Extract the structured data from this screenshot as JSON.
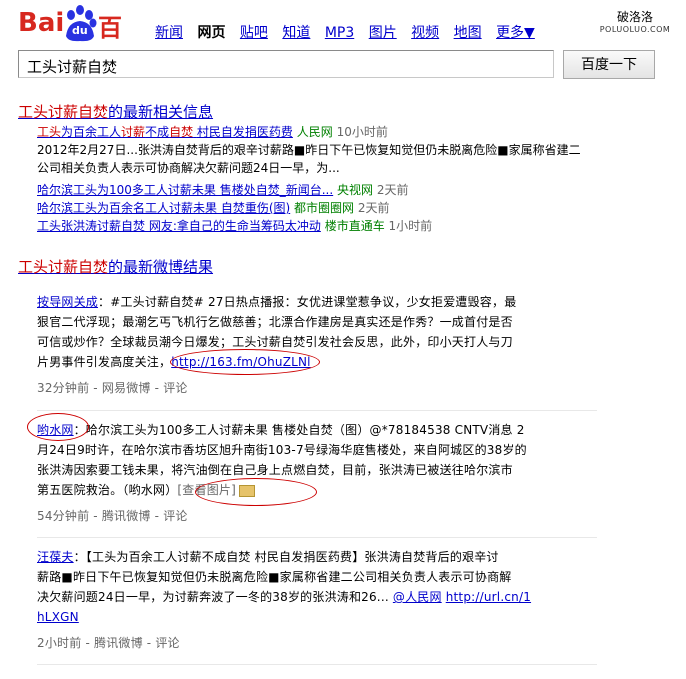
{
  "logo": {
    "bai": "Bai",
    "du": "du",
    "cn": "百度"
  },
  "nav": [
    {
      "label": "新闻",
      "current": false
    },
    {
      "label": "网页",
      "current": true
    },
    {
      "label": "贴吧",
      "current": false
    },
    {
      "label": "知道",
      "current": false
    },
    {
      "label": "MP3",
      "current": false
    },
    {
      "label": "图片",
      "current": false
    },
    {
      "label": "视频",
      "current": false
    },
    {
      "label": "地图",
      "current": false
    },
    {
      "label": "更多▼",
      "current": false
    }
  ],
  "corner": {
    "cn": "破洛洛",
    "en": "POLUOLUO.COM"
  },
  "search": {
    "query": "工头讨薪自焚",
    "button": "百度一下"
  },
  "news": {
    "heading_em": "工头讨薪自焚",
    "heading_rest": "的最新相关信息",
    "top": {
      "title_parts": [
        "工头",
        "为百余工人",
        "讨薪",
        "不成",
        "自焚",
        "村民自发捐医药费"
      ],
      "source": "人民网",
      "time": "10小时前",
      "snippet": "2012年2月27日...张洪涛自焚背后的艰辛讨薪路■昨日下午已恢复知觉但仍未脱离危险■家属称省建二公司相关负责人表示可协商解决欠薪问题24日一早，为..."
    },
    "items": [
      {
        "title": "哈尔滨工头为100多工人讨薪未果 售楼处自焚_新闻台...",
        "source": "央视网",
        "time": "2天前"
      },
      {
        "title": "哈尔滨工头为百余名工人讨薪未果 自焚重伤(图)",
        "source": "都市圈圈网",
        "time": "2天前"
      },
      {
        "title": "工头张洪涛讨薪自焚 网友:拿自己的生命当筹码太冲动",
        "source": "楼市直通车",
        "time": "1小时前"
      }
    ]
  },
  "weibo": {
    "heading_em": "工头讨薪自焚",
    "heading_rest": "的最新微博结果",
    "posts": [
      {
        "user": "按导网关成",
        "line1": "：#工头讨薪自焚# 27日热点播报：女优进课堂惹争议，少女拒爱遭毁容，最",
        "line2": "狠官二代浮现；最潮乞丐飞机行乞做慈善；北漂合作建房是真实还是作秀？一成首付是否",
        "line3": "可信或炒作？全球裁员潮今日爆发；工头讨薪自焚引发社会反思，此外，印小天打人与刀",
        "line4": "片男事件引发高度关注，",
        "link": "http://163.fm/OhuZLNl",
        "meta": "32分钟前 - 网易微博 - 评论"
      },
      {
        "user": "哟水网",
        "line1": "：哈尔滨工头为100多工人讨薪未果 售楼处自焚（图）@*78184538 CNTV消息 2",
        "line2": "月24日9时许，在哈尔滨市香坊区旭升南街103-7号绿海华庭售楼处，来自阿城区的38岁的",
        "line3": "张洪涛因索要工钱未果，将汽油倒在自己身上点燃自焚，目前，张洪涛已被送往哈尔滨市",
        "line4": "第五医院救治。（哟水网）",
        "link": "[查看图片]",
        "meta": "54分钟前 - 腾讯微博 - 评论"
      },
      {
        "user": "汪葆夫",
        "line1": "：【工头为百余工人讨薪不成自焚 村民自发捐医药费】张洪涛自焚背后的艰辛讨",
        "line2": "薪路■昨日下午已恢复知觉但仍未脱离危险■家属称省建二公司相关负责人表示可协商解",
        "line3": "决欠薪问题24日一早，为讨薪奔波了一冬的38岁的张洪涛和26...",
        "line3b": "@人民网",
        "line3c": "http://url.cn/1",
        "line4": "hLXGN",
        "meta": "2小时前 - 腾讯微博 - 评论"
      }
    ]
  }
}
